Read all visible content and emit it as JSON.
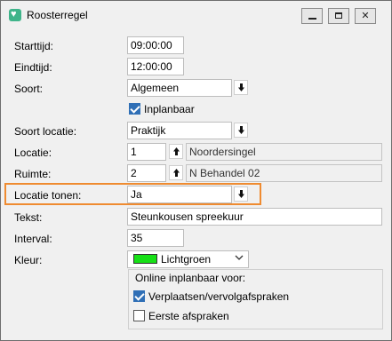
{
  "window": {
    "title": "Roosterregel"
  },
  "form": {
    "starttijd": {
      "label": "Starttijd:",
      "value": "09:00:00"
    },
    "eindtijd": {
      "label": "Eindtijd:",
      "value": "12:00:00"
    },
    "soort": {
      "label": "Soort:",
      "value": "Algemeen"
    },
    "inplanbaar": {
      "label": "Inplanbaar",
      "checked": true
    },
    "soort_locatie": {
      "label": "Soort locatie:",
      "value": "Praktijk"
    },
    "locatie": {
      "label": "Locatie:",
      "code": "1",
      "name": "Noordersingel"
    },
    "ruimte": {
      "label": "Ruimte:",
      "code": "2",
      "name": "N Behandel 02"
    },
    "locatie_tonen": {
      "label": "Locatie tonen:",
      "value": "Ja"
    },
    "tekst": {
      "label": "Tekst:",
      "value": "Steunkousen spreekuur"
    },
    "interval": {
      "label": "Interval:",
      "value": "35"
    },
    "kleur": {
      "label": "Kleur:",
      "value": "Lichtgroen",
      "swatch_color": "#16e016"
    }
  },
  "online_group": {
    "title": "Online inplanbaar voor:",
    "options": [
      {
        "label": "Verplaatsen/vervolgafspraken",
        "checked": true
      },
      {
        "label": "Eerste afspraken",
        "checked": false
      }
    ]
  },
  "colors": {
    "highlight": "#ef8b30",
    "checkbox_accent": "#2f6fb6"
  }
}
